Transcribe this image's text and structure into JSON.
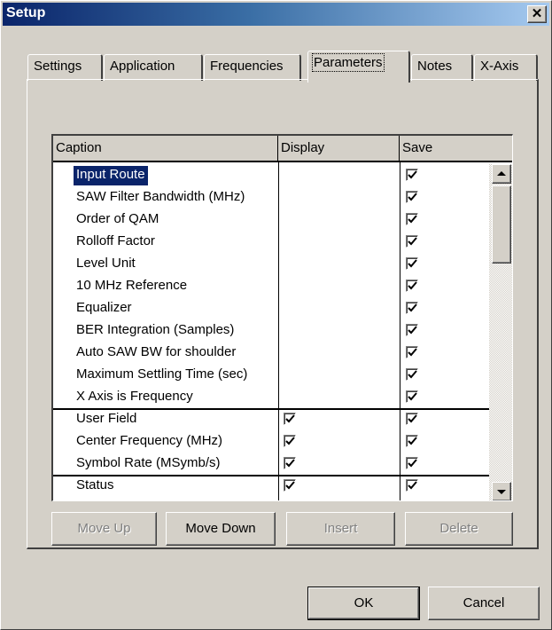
{
  "window": {
    "title": "Setup",
    "close_glyph": "✕"
  },
  "tabs": [
    {
      "label": "Settings",
      "active": false
    },
    {
      "label": "Application",
      "active": false
    },
    {
      "label": "Frequencies",
      "active": false
    },
    {
      "label": "Parameters",
      "active": true
    },
    {
      "label": "Notes",
      "active": false
    },
    {
      "label": "X-Axis",
      "active": false
    }
  ],
  "grid": {
    "columns": [
      "Caption",
      "Display",
      "Save"
    ],
    "rows": [
      {
        "caption": "Input Route",
        "display": false,
        "save": true,
        "selected": true
      },
      {
        "caption": "SAW Filter Bandwidth (MHz)",
        "display": false,
        "save": true
      },
      {
        "caption": "Order of QAM",
        "display": false,
        "save": true
      },
      {
        "caption": "Rolloff Factor",
        "display": false,
        "save": true
      },
      {
        "caption": "Level Unit",
        "display": false,
        "save": true
      },
      {
        "caption": "10 MHz Reference",
        "display": false,
        "save": true
      },
      {
        "caption": "Equalizer",
        "display": false,
        "save": true
      },
      {
        "caption": "BER Integration (Samples)",
        "display": false,
        "save": true
      },
      {
        "caption": "Auto SAW BW for shoulder",
        "display": false,
        "save": true
      },
      {
        "caption": "Maximum Settling Time (sec)",
        "display": false,
        "save": true
      },
      {
        "caption": "X Axis is Frequency",
        "display": false,
        "save": true
      },
      {
        "caption": "User Field",
        "display": true,
        "save": true
      },
      {
        "caption": "Center Frequency (MHz)",
        "display": true,
        "save": true
      },
      {
        "caption": "Symbol Rate (MSymb/s)",
        "display": true,
        "save": true
      },
      {
        "caption": "Status",
        "display": true,
        "save": true
      }
    ]
  },
  "buttons": {
    "move_up": "Move Up",
    "move_down": "Move Down",
    "insert": "Insert",
    "delete": "Delete",
    "ok": "OK",
    "cancel": "Cancel"
  },
  "colors": {
    "title_bar_start": "#0a246a",
    "title_bar_end": "#a6caf0",
    "face": "#d4d0c8",
    "selection": "#0a246a"
  }
}
